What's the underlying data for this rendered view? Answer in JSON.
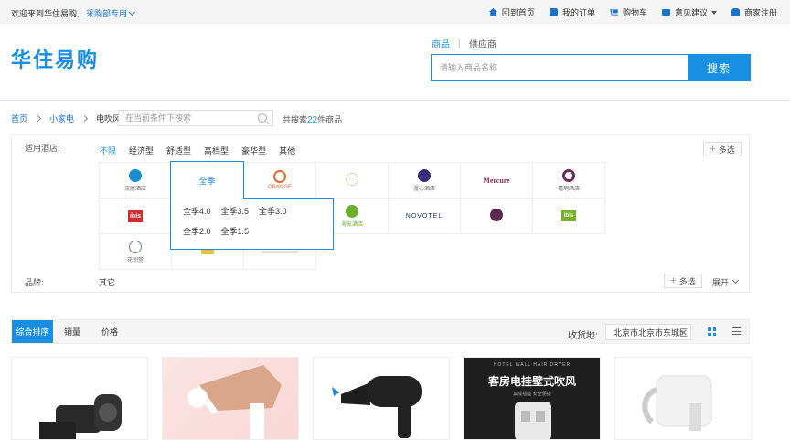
{
  "topbar": {
    "welcome": "欢迎来到华住易购,",
    "dept": "采购部专用",
    "nav": [
      {
        "label": "回到首页",
        "icon": "home-icon"
      },
      {
        "label": "我的订单",
        "icon": "order-icon"
      },
      {
        "label": "购物车",
        "icon": "cart-icon"
      },
      {
        "label": "意见建议",
        "icon": "mail-icon"
      },
      {
        "label": "商家注册",
        "icon": "shop-icon"
      }
    ]
  },
  "header": {
    "logo": "华住易购",
    "tabs": [
      "商品",
      "供应商"
    ],
    "search_placeholder": "请输入商品名称",
    "search_button": "搜索"
  },
  "breadcrumb": {
    "items": [
      "首页",
      "小家电",
      "电吹风"
    ],
    "filter_placeholder": "在当前条件下搜索",
    "count_prefix": "共搜索",
    "count_value": "22",
    "count_suffix": "件商品"
  },
  "filters": {
    "hotel_label": "适用酒店:",
    "hotel_types": [
      "不限",
      "经济型",
      "舒适型",
      "高档型",
      "豪华型",
      "其他"
    ],
    "multi_select": "多选",
    "brands": [
      {
        "name": "汉庭酒店",
        "color": "#1b8fcf"
      },
      {
        "name": "全季",
        "color": "#1a8ee0"
      },
      {
        "name": "ORANGE",
        "color": "#e06a2c"
      },
      {
        "name": "",
        "color": "#c9a36b"
      },
      {
        "name": "漫心酒店",
        "color": "#3a2b7a"
      },
      {
        "name": "Mercure",
        "color": "#8a2b5c"
      },
      {
        "name": "禧玥酒店",
        "color": "#6a2b5c"
      },
      {
        "name": "ibis",
        "color": "#d42b2b"
      },
      {
        "name": "",
        "color": "#cccccc"
      },
      {
        "name": "",
        "color": "#cccccc"
      },
      {
        "name": "海友酒店",
        "color": "#6ab02c"
      },
      {
        "name": "NOVOTEL",
        "color": "#1a3a6a"
      },
      {
        "name": "",
        "color": "#5a2b4c"
      },
      {
        "name": "ibis",
        "color": "#7ab02c"
      },
      {
        "name": "花间堂",
        "color": "#6a8a6a"
      },
      {
        "name": "",
        "color": "#e8c02c"
      },
      {
        "name": "",
        "color": "#bbbbbb"
      }
    ],
    "ji_versions": [
      "全季4.0",
      "全季3.5",
      "全季3.0",
      "全季2.0",
      "全季1.5"
    ],
    "brand_label": "品牌:",
    "brand_other": "其它",
    "expand": "展开"
  },
  "sortbar": {
    "options": [
      "综合排序",
      "销量",
      "价格"
    ],
    "ship_label": "收货地:",
    "ship_value": "北京市北京市东城区"
  },
  "products": [
    {
      "type": "dark-dryer"
    },
    {
      "type": "pink-dryer"
    },
    {
      "type": "black-dryer"
    },
    {
      "type": "wall-dryer",
      "title": "客房电挂壁式吹风",
      "sub": "HOTEL WALL HAIR DRYER",
      "note": "集成插座  安全便捷"
    },
    {
      "type": "white-dryer"
    }
  ]
}
